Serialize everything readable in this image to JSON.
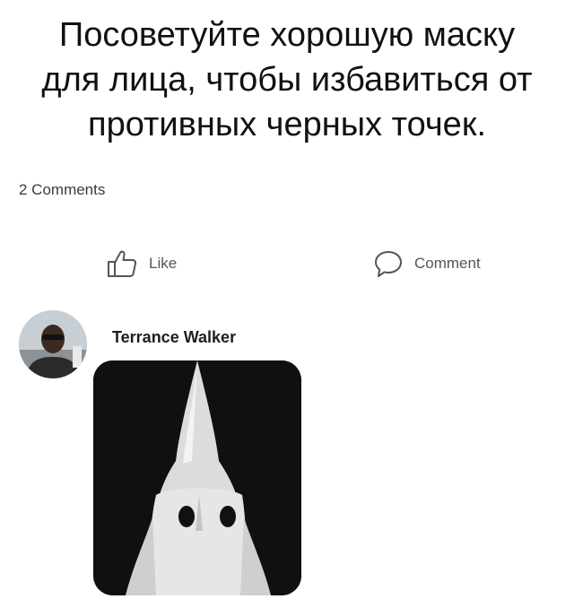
{
  "post": {
    "text_lines": [
      "Посоветуйте хорошую маску",
      "для лица, чтобы избавиться от",
      "противных черных точек."
    ]
  },
  "stats": {
    "comments": "2 Comments"
  },
  "actions": {
    "like_label": "Like",
    "comment_label": "Comment"
  },
  "comment": {
    "author": "Terrance Walker"
  },
  "icons": {
    "like": "thumbs-up-icon",
    "comment": "speech-bubble-icon"
  }
}
